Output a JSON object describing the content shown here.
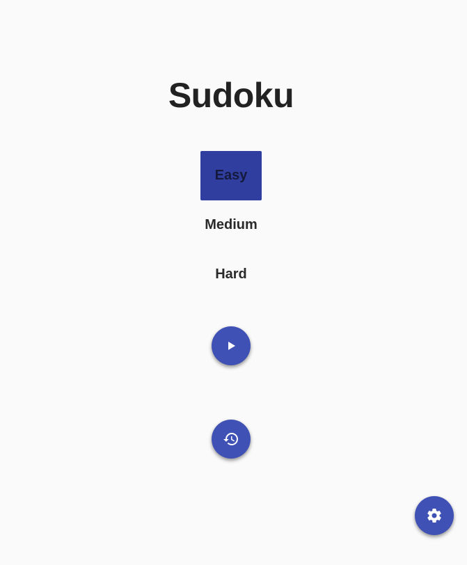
{
  "app": {
    "title": "Sudoku"
  },
  "difficulty": {
    "options": [
      {
        "label": "Easy",
        "selected": true
      },
      {
        "label": "Medium",
        "selected": false
      },
      {
        "label": "Hard",
        "selected": false
      }
    ]
  },
  "actions": {
    "play_icon": "play-icon",
    "history_icon": "history-icon",
    "settings_icon": "gear-icon"
  },
  "colors": {
    "background": "#fafafa",
    "accent": "#3f51b5",
    "selected": "#303f9f",
    "text": "#212121"
  }
}
